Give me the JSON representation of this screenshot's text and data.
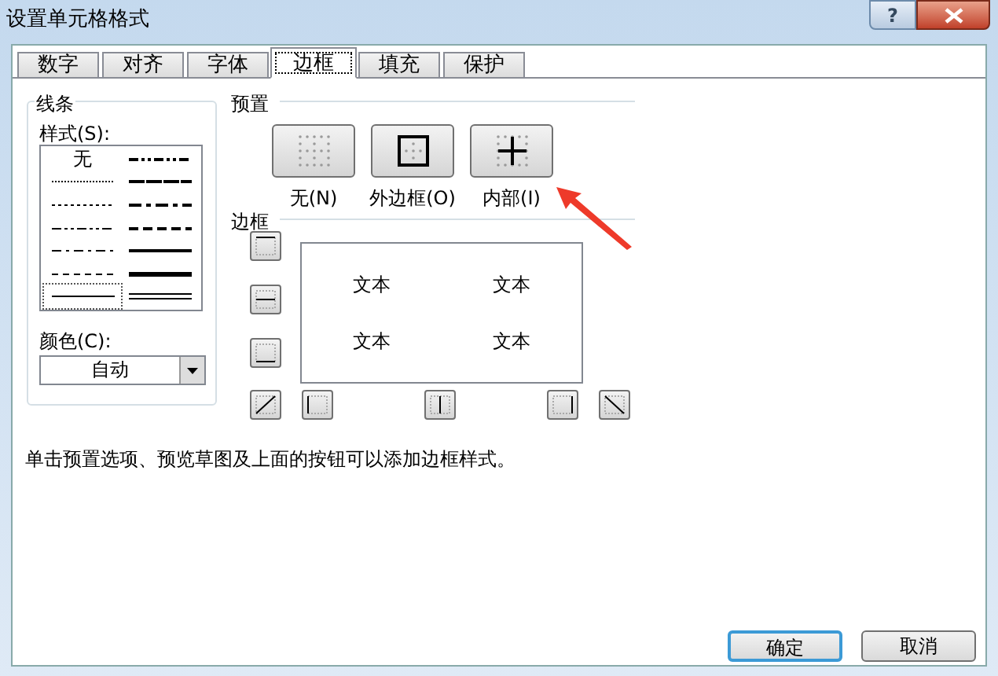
{
  "window": {
    "title": "设置单元格格式",
    "help_button": "?"
  },
  "tabs": [
    {
      "label": "数字",
      "selected": false
    },
    {
      "label": "对齐",
      "selected": false
    },
    {
      "label": "字体",
      "selected": false
    },
    {
      "label": "边框",
      "selected": true
    },
    {
      "label": "填充",
      "selected": false
    },
    {
      "label": "保护",
      "selected": false
    }
  ],
  "line": {
    "title": "线条",
    "style_label": "样式(S):",
    "styles": [
      {
        "kind": "none",
        "label": "无",
        "selected": false
      },
      {
        "kind": "hair",
        "selected": false
      },
      {
        "kind": "dotted",
        "selected": false
      },
      {
        "kind": "dashdotdot",
        "selected": false
      },
      {
        "kind": "dashdot",
        "selected": false
      },
      {
        "kind": "dashed",
        "selected": false
      },
      {
        "kind": "thin",
        "selected": true
      },
      {
        "kind": "medium-dashdotdot",
        "selected": false
      },
      {
        "kind": "slanted",
        "selected": false
      },
      {
        "kind": "medium-dashdot",
        "selected": false
      },
      {
        "kind": "medium-dashed",
        "selected": false
      },
      {
        "kind": "medium",
        "selected": false
      },
      {
        "kind": "thick",
        "selected": false
      },
      {
        "kind": "double",
        "selected": false
      }
    ],
    "color_label": "颜色(C):",
    "color_value": "自动"
  },
  "presets": {
    "title": "预置",
    "items": [
      {
        "kind": "none",
        "label": "无(N)"
      },
      {
        "kind": "outline",
        "label": "外边框(O)"
      },
      {
        "kind": "inside",
        "label": "内部(I)"
      }
    ]
  },
  "border": {
    "title": "边框",
    "preview_texts": [
      "文本",
      "文本",
      "文本",
      "文本"
    ]
  },
  "hint": "单击预置选项、预览草图及上面的按钮可以添加边框样式。",
  "buttons": [
    {
      "label": "确定",
      "default": true
    },
    {
      "label": "取消",
      "default": false
    }
  ]
}
